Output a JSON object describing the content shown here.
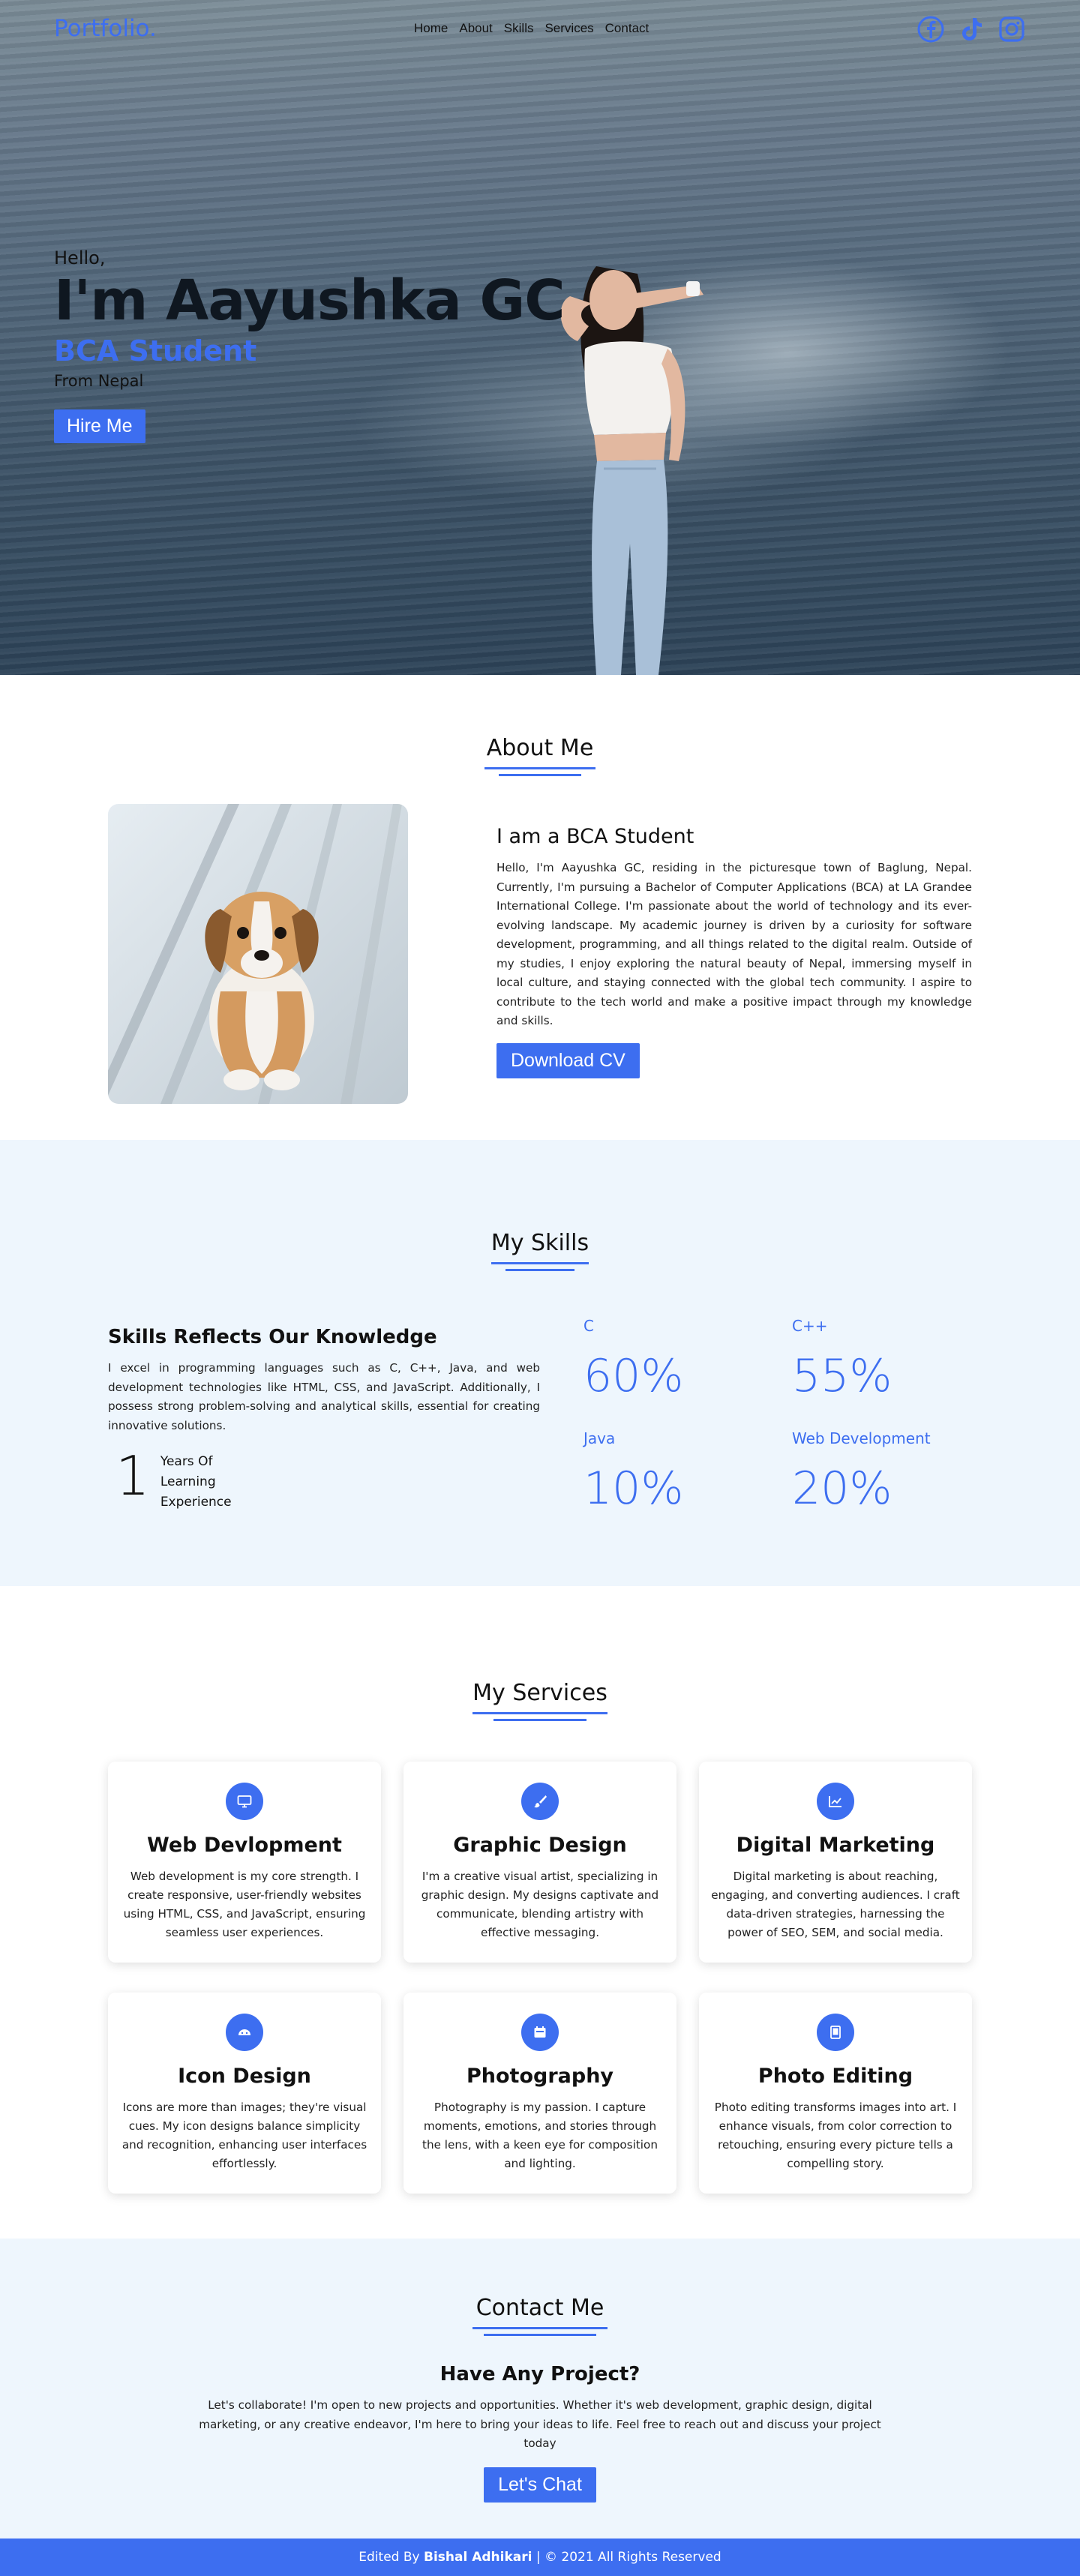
{
  "nav": {
    "logo": "Portfolio.",
    "links": [
      "Home",
      "About",
      "Skills",
      "Services",
      "Contact"
    ],
    "socials": [
      "facebook-icon",
      "tiktok-icon",
      "instagram-icon"
    ]
  },
  "hero": {
    "greeting": "Hello,",
    "name": "I'm Aayushka GC",
    "role": "BCA Student",
    "origin": "From Nepal",
    "cta": "Hire Me"
  },
  "about": {
    "title": "About Me",
    "subtitle": "I am a BCA Student",
    "paragraph": "Hello, I'm Aayushka GC, residing in the picturesque town of Baglung, Nepal. Currently, I'm pursuing a Bachelor of Computer Applications (BCA) at LA Grandee International College. I'm passionate about the world of technology and its ever-evolving landscape. My academic journey is driven by a curiosity for software development, programming, and all things related to the digital realm. Outside of my studies, I enjoy exploring the natural beauty of Nepal, immersing myself in local culture, and staying connected with the global tech community. I aspire to contribute to the tech world and make a positive impact through my knowledge and skills.",
    "cta": "Download CV"
  },
  "skills": {
    "title": "My Skills",
    "subtitle": "Skills Reflects Our Knowledge",
    "paragraph": "I excel in programming languages such as C, C++, Java, and web development technologies like HTML, CSS, and JavaScript. Additionally, I possess strong problem-solving and analytical skills, essential for creating innovative solutions.",
    "years_number": "1",
    "years_label": [
      "Years Of",
      "Learning",
      "Experience"
    ],
    "items": [
      {
        "name": "C",
        "value": "60%"
      },
      {
        "name": "C++",
        "value": "55%"
      },
      {
        "name": "Java",
        "value": "10%"
      },
      {
        "name": "Web Development",
        "value": "20%"
      }
    ]
  },
  "services": {
    "title": "My Services",
    "items": [
      {
        "icon": "monitor-icon",
        "title": "Web Devlopment",
        "text": "Web development is my core strength. I create responsive, user-friendly websites using HTML, CSS, and JavaScript, ensuring seamless user experiences."
      },
      {
        "icon": "brush-icon",
        "title": "Graphic Design",
        "text": "I'm a creative visual artist, specializing in graphic design. My designs captivate and communicate, blending artistry with effective messaging."
      },
      {
        "icon": "chart-icon",
        "title": "Digital Marketing",
        "text": "Digital marketing is about reaching, engaging, and converting audiences. I craft data-driven strategies, harnessing the power of SEO, SEM, and social media."
      },
      {
        "icon": "cloud-icon",
        "title": "Icon Design",
        "text": "Icons are more than images; they're visual cues. My icon designs balance simplicity and recognition, enhancing user interfaces effortlessly."
      },
      {
        "icon": "camera-icon",
        "title": "Photography",
        "text": "Photography is my passion. I capture moments, emotions, and stories through the lens, with a keen eye for composition and lighting."
      },
      {
        "icon": "tablet-icon",
        "title": "Photo Editing",
        "text": "Photo editing transforms images into art. I enhance visuals, from color correction to retouching, ensuring every picture tells a compelling story."
      }
    ]
  },
  "contact": {
    "title": "Contact Me",
    "subtitle": "Have Any Project?",
    "paragraph": "Let's collaborate! I'm open to new projects and opportunities. Whether it's web development, graphic design, digital marketing, or any creative endeavor, I'm here to bring your ideas to life. Feel free to reach out and discuss your project today",
    "cta": "Let's Chat"
  },
  "footer": {
    "prefix": "Edited By ",
    "author": "Bishal Adhikari",
    "suffix": " | © 2021 All Rights Reserved"
  },
  "colors": {
    "accent": "#3d6ef0",
    "section_bg": "#eef6fd",
    "text": "#111111"
  }
}
